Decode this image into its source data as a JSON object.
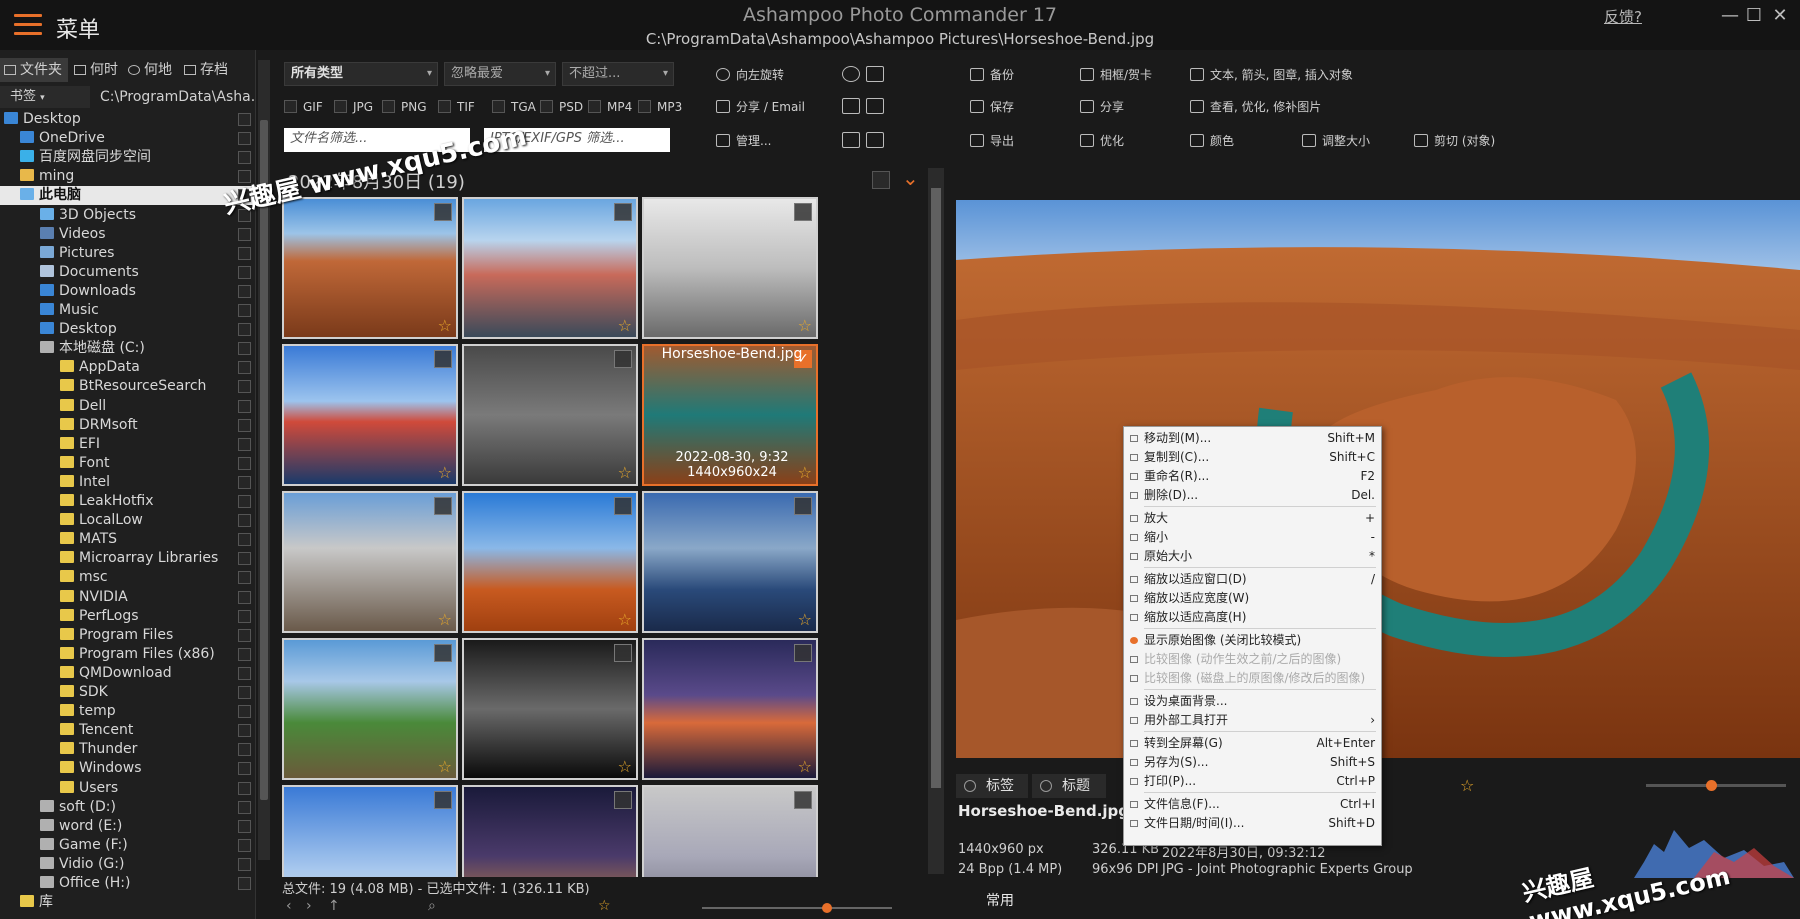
{
  "titlebar": {
    "menu_label": "菜单",
    "app_title": "Ashampoo Photo Commander 17",
    "file_path": "C:\\ProgramData\\Ashampoo\\Ashampoo Pictures\\Horseshoe-Bend.jpg",
    "feedback": "反馈?"
  },
  "left": {
    "tabs": [
      "文件夹",
      "何时",
      "何地",
      "存档"
    ],
    "bookmark": "书签",
    "path": "C:\\ProgramData\\Asha..."
  },
  "tree": [
    {
      "label": "Desktop"
    },
    {
      "label": "OneDrive"
    },
    {
      "label": "百度网盘同步空间"
    },
    {
      "label": "ming"
    },
    {
      "label": "此电脑"
    },
    {
      "label": "3D Objects"
    },
    {
      "label": "Videos"
    },
    {
      "label": "Pictures"
    },
    {
      "label": "Documents"
    },
    {
      "label": "Downloads"
    },
    {
      "label": "Music"
    },
    {
      "label": "Desktop"
    },
    {
      "label": "本地磁盘 (C:)"
    },
    {
      "label": "AppData"
    },
    {
      "label": "BtResourceSearch"
    },
    {
      "label": "Dell"
    },
    {
      "label": "DRMsoft"
    },
    {
      "label": "EFI"
    },
    {
      "label": "Font"
    },
    {
      "label": "Intel"
    },
    {
      "label": "LeakHotfix"
    },
    {
      "label": "LocalLow"
    },
    {
      "label": "MATS"
    },
    {
      "label": "Microarray Libraries"
    },
    {
      "label": "msc"
    },
    {
      "label": "NVIDIA"
    },
    {
      "label": "PerfLogs"
    },
    {
      "label": "Program Files"
    },
    {
      "label": "Program Files (x86)"
    },
    {
      "label": "QMDownload"
    },
    {
      "label": "SDK"
    },
    {
      "label": "temp"
    },
    {
      "label": "Tencent"
    },
    {
      "label": "Thunder"
    },
    {
      "label": "Windows"
    },
    {
      "label": "Users"
    },
    {
      "label": "soft (D:)"
    },
    {
      "label": "word (E:)"
    },
    {
      "label": "Game (F:)"
    },
    {
      "label": "Vidio (G:)"
    },
    {
      "label": "Office (H:)"
    },
    {
      "label": "库"
    }
  ],
  "filter": {
    "type": "所有类型",
    "rating": "忽略最爱",
    "limit": "不超过...",
    "types": [
      "GIF",
      "JPG",
      "PNG",
      "TIF",
      "TGA",
      "PSD",
      "MP4",
      "MP3"
    ],
    "name_placeholder": "文件名筛选...",
    "meta_placeholder": "IPTC/EXIF/GPS 筛选..."
  },
  "toolbar": {
    "rotate_left": "向左旋转",
    "share_email": "分享 / Email",
    "manage": "管理...",
    "backup": "备份",
    "save": "保存",
    "export": "导出",
    "frame": "相框/贺卡",
    "share": "分享",
    "optimize": "优化",
    "color": "颜色",
    "text_tools": "文本, 箭头, 图章, 插入对象",
    "view_opt": "查看, 优化, 修补图片",
    "resize": "调整大小",
    "cut": "剪切 (对象)"
  },
  "grid": {
    "date_label": "2022年8月30日 (19)",
    "selected_name": "Horseshoe-Bend.jpg",
    "selected_date": "2022-08-30, 9:32",
    "selected_dims": "1440x960x24"
  },
  "status": {
    "text": "总文件: 19 (4.08 MB) - 已选中文件: 1 (326.11 KB)"
  },
  "info": {
    "tab_tags": "标签",
    "tab_title": "标题",
    "name": "Horseshoe-Bend.jpg",
    "dims": "1440x960 px",
    "size": "326.11 KB",
    "date": "2022年8月30日, 09:32:12",
    "bpp": "24 Bpp (1.4 MP)",
    "dpi": "96x96 DPI",
    "format": "JPG - Joint Photographic Experts Group",
    "common": "常用"
  },
  "context_menu": [
    {
      "label": "移动到(M)...",
      "shortcut": "Shift+M"
    },
    {
      "label": "复制到(C)...",
      "shortcut": "Shift+C"
    },
    {
      "label": "重命名(R)...",
      "shortcut": "F2"
    },
    {
      "label": "删除(D)...",
      "shortcut": "Del."
    },
    {
      "label": "放大",
      "shortcut": "+"
    },
    {
      "label": "缩小",
      "shortcut": "-"
    },
    {
      "label": "原始大小",
      "shortcut": "*"
    },
    {
      "label": "缩放以适应窗口(D)",
      "shortcut": "/"
    },
    {
      "label": "缩放以适应宽度(W)",
      "shortcut": ""
    },
    {
      "label": "缩放以适应高度(H)",
      "shortcut": ""
    },
    {
      "label": "显示原始图像 (关闭比较模式)",
      "shortcut": ""
    },
    {
      "label": "比较图像 (动作生效之前/之后的图像)",
      "shortcut": ""
    },
    {
      "label": "比较图像 (磁盘上的原图像/修改后的图像)",
      "shortcut": ""
    },
    {
      "label": "设为桌面背景...",
      "shortcut": ""
    },
    {
      "label": "用外部工具打开",
      "shortcut": "›"
    },
    {
      "label": "转到全屏幕(G)",
      "shortcut": "Alt+Enter"
    },
    {
      "label": "另存为(S)...",
      "shortcut": "Shift+S"
    },
    {
      "label": "打印(P)...",
      "shortcut": "Ctrl+P"
    },
    {
      "label": "文件信息(F)...",
      "shortcut": "Ctrl+I"
    },
    {
      "label": "文件日期/时间(I)...",
      "shortcut": "Shift+D"
    }
  ],
  "watermark": "兴趣屋 www.xqu5.com",
  "colors": {
    "accent": "#e8702a",
    "background": "#1a1a1a"
  }
}
